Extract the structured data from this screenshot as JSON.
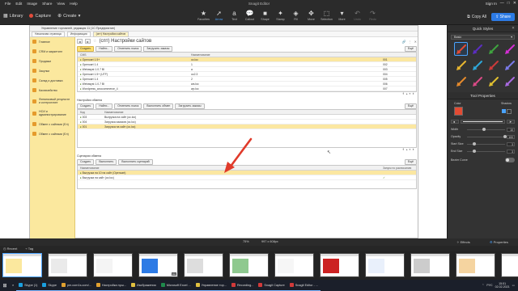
{
  "app": {
    "title": "Snagit Editor",
    "menu": [
      "File",
      "Edit",
      "Image",
      "Share",
      "View",
      "Help"
    ],
    "sign_in": "Sign In",
    "win_controls": [
      "—",
      "□",
      "✕"
    ]
  },
  "toolbar": {
    "library_label": "Library",
    "capture_label": "Capture",
    "create_label": "Create",
    "tools": [
      {
        "label": "Favorites",
        "icon": "★"
      },
      {
        "label": "Arrow",
        "icon": "➚"
      },
      {
        "label": "Text",
        "icon": "a"
      },
      {
        "label": "Callout",
        "icon": "💬"
      },
      {
        "label": "Shape",
        "icon": "■"
      },
      {
        "label": "Stamp",
        "icon": "✦"
      },
      {
        "label": "Fill",
        "icon": "◈"
      },
      {
        "label": "Move",
        "icon": "✥"
      },
      {
        "label": "Selection",
        "icon": "⬚"
      },
      {
        "label": "Undo",
        "icon": "↶"
      },
      {
        "label": "Redo",
        "icon": "↷"
      }
    ],
    "more_label": "More",
    "copy_all_label": "Copy All",
    "share_label": "Share"
  },
  "doc": {
    "window_title": "Управление торговлей, редакция 11 (1С:Предприятие)",
    "nav_tabs": [
      "Начальная страница",
      "Информация",
      "(спт) Настройки сайтов"
    ],
    "sidebar": [
      "Главное",
      "CRM и маркетинг",
      "Продажи",
      "Закупки",
      "Склад и доставка",
      "Казначейство",
      "Финансовый результат и контроллинг",
      "НСИ и администрирование",
      "Обмен с сайтами (Ел)",
      "Обмен с сайтами (Ел)"
    ],
    "form_title": "(спт) Настройки сайтов",
    "cmd1": [
      "Создать",
      "Найти...",
      "Отменить поиск",
      "Загрузить заказы"
    ],
    "grid1": {
      "headers": [
        "CMS",
        "Наименование",
        ""
      ],
      "rows": [
        {
          "name": "Opencart 1.5+",
          "value": "oc.loc",
          "code": "001"
        },
        {
          "name": "Opencart 1.4",
          "value": "1",
          "code": "002"
        },
        {
          "name": "Webasyst 1.0.7 Bl",
          "value": "a",
          "code": "003"
        },
        {
          "name": "Opencart 1.5+ (UTF)",
          "value": "oc2.3",
          "code": "004"
        },
        {
          "name": "Opencart 1.4",
          "value": "2",
          "code": "005"
        },
        {
          "name": "Webasyst 1.0.7 Bl",
          "value": "wa.loc",
          "code": "006"
        },
        {
          "name": "Wordpress_woocommerce_4",
          "value": "wp.loc",
          "code": "007"
        }
      ]
    },
    "section2": "Настройки обмена",
    "cmd2": [
      "Создать",
      "Найти...",
      "Отменить поиск",
      "Выполнить обмен",
      "Загрузить заказы"
    ],
    "grid2": {
      "headers": [
        "Код",
        "Наименование"
      ],
      "rows": [
        {
          "code": "003",
          "name": "Выгрузка на сайт (oc.loc)"
        },
        {
          "code": "004",
          "name": "Загрузка заказов (oc.loc)"
        },
        {
          "code": "001",
          "name": "Загрузка на сайт (oc.loc)"
        }
      ]
    },
    "section3": "Сценарии обмена",
    "cmd3": [
      "Создать",
      "Выполнить",
      "Выполнить сценарий"
    ],
    "grid3": {
      "headers": [
        "Наименование",
        "Запуск по расписанию"
      ],
      "rows": [
        {
          "name": "Выгрузка на 10 на сайт (Opencart)",
          "flag": ""
        },
        {
          "name": "Выгрузка на сайт (oc.loc)",
          "flag": "✓"
        }
      ]
    },
    "more_label": "Ещё"
  },
  "canvas_bar": {
    "zoom": "75%",
    "dims": "997 x 608px"
  },
  "panel": {
    "quick_styles_title": "Quick Styles",
    "style_name": "Basic",
    "quick_style_colors": [
      "#e34b33",
      "#5b2dc0",
      "#3fa33f",
      "#d42ed4",
      "#e8b630",
      "#2ea6d8",
      "#cc3a3a",
      "#7a7ae8",
      "#e58a2c",
      "#d94a86",
      "#e0c030",
      "#a86ae0"
    ],
    "tool_properties_title": "Tool Properties",
    "color_label": "Color",
    "shadow_label": "Shadow",
    "props": [
      {
        "label": "Width",
        "value": "10",
        "level": 0.45
      },
      {
        "label": "Opacity",
        "value": "100",
        "level": 1.0
      },
      {
        "label": "Start Size",
        "value": "3",
        "level": 0.2
      },
      {
        "label": "End Size",
        "value": "3",
        "level": 0.2
      }
    ],
    "bezier_label": "Bezier Curve"
  },
  "panel_foot": {
    "effects_label": "Effects",
    "properties_label": "Properties"
  },
  "tray": {
    "recent_label": "Recent",
    "tag_label": "Tag",
    "thumbs": [
      "",
      "",
      "",
      "jpg",
      "",
      "",
      "",
      "",
      "",
      "",
      "",
      ""
    ]
  },
  "taskbar": {
    "tasks": [
      {
        "label": "Skype (1)",
        "color": "#1a9fe0"
      },
      {
        "label": "Skype",
        "color": "#1a9fe0"
      },
      {
        "label": "pm.com1s.com/...",
        "color": "#e0a030"
      },
      {
        "label": "Настройка пуш...",
        "color": "#e0a030"
      },
      {
        "label": "Изображения",
        "color": "#e0c040"
      },
      {
        "label": "Microsoft Excel ...",
        "color": "#1f8a4c"
      },
      {
        "label": "Управление тор...",
        "color": "#e0c040"
      },
      {
        "label": "Recording...",
        "color": "#d23a3a"
      },
      {
        "label": "Snagit Capture",
        "color": "#d23a3a"
      },
      {
        "label": "Snagit Editor - ...",
        "color": "#d23a3a"
      }
    ],
    "lang": "РУС",
    "time": "15:51",
    "date": "02.02.2021"
  }
}
